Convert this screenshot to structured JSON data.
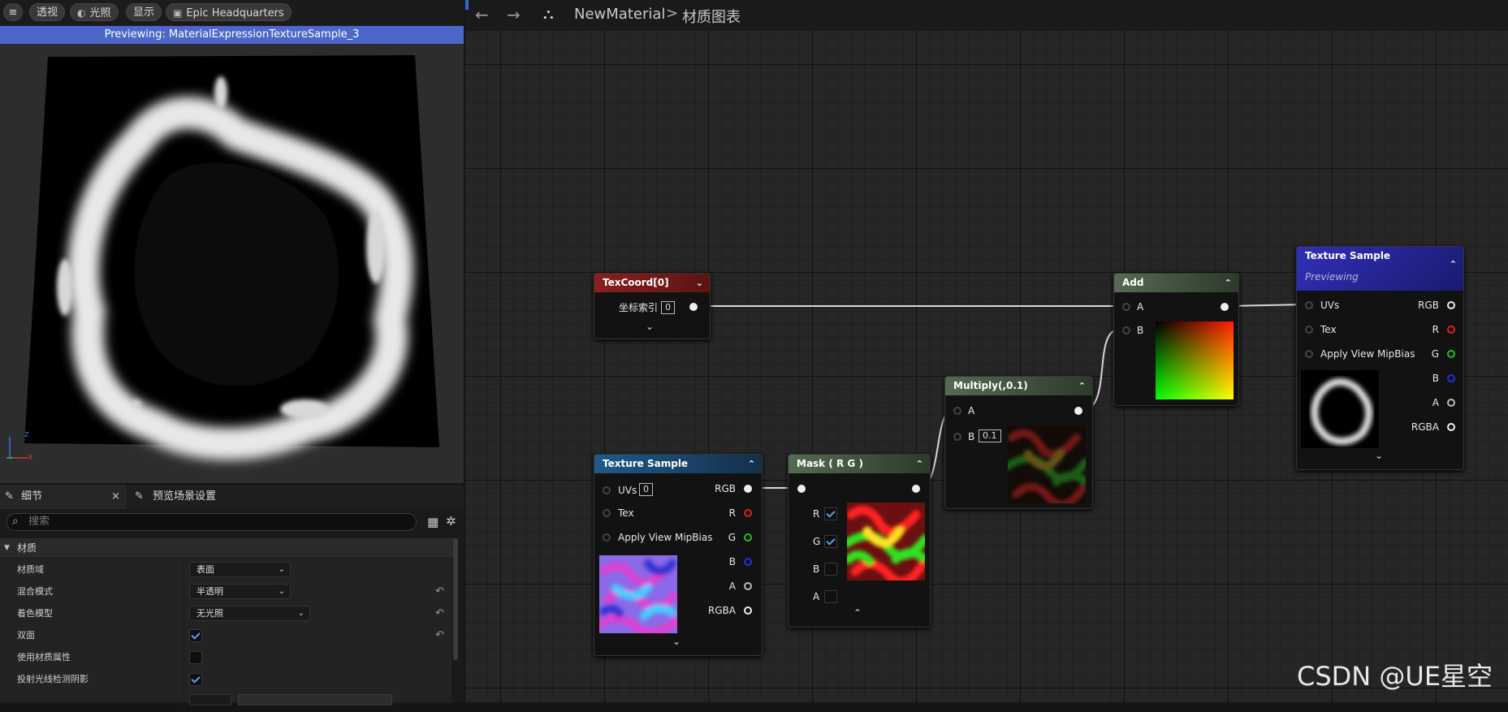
{
  "viewport": {
    "toolbar": {
      "menu_icon": "hamburger-icon",
      "perspective_label": "透视",
      "lit_label": "光照",
      "show_label": "显示",
      "scene_label": "Epic Headquarters"
    },
    "preview_status": "Previewing: MaterialExpressionTextureSample_3",
    "axis": {
      "x": "x",
      "z": "z"
    }
  },
  "details": {
    "tabs": [
      {
        "label": "细节"
      },
      {
        "label": "预览场景设置"
      }
    ],
    "close_glyph": "×",
    "search_placeholder": "搜索",
    "category": "材质",
    "rows": [
      {
        "label": "材质域",
        "type": "dropdown",
        "value": "表面"
      },
      {
        "label": "混合模式",
        "type": "dropdown",
        "value": "半透明"
      },
      {
        "label": "着色模型",
        "type": "dropdown",
        "value": "无光照"
      },
      {
        "label": "双面",
        "type": "checkbox",
        "checked": true
      },
      {
        "label": "使用材质属性",
        "type": "checkbox",
        "checked": false
      },
      {
        "label": "投射光线检测阴影",
        "type": "checkbox",
        "checked": true
      }
    ]
  },
  "graph": {
    "breadcrumb": {
      "asset": "NewMaterial",
      "separator": ">",
      "page": "材质图表"
    },
    "nodes": {
      "texcoord": {
        "title": "TexCoord[0]",
        "index_label": "坐标索引",
        "index_value": "0",
        "color": "#8a1f1f"
      },
      "texture_sample_left": {
        "title": "Texture Sample",
        "color": "#1e4f7a",
        "inputs": [
          "UVs",
          "Tex",
          "Apply View MipBias"
        ],
        "uv_value": "0",
        "outputs": [
          "RGB",
          "R",
          "G",
          "B",
          "A",
          "RGBA"
        ]
      },
      "mask": {
        "title": "Mask ( R G )",
        "color": "#4b6a46",
        "channels": [
          "R",
          "G",
          "B",
          "A"
        ],
        "checked": [
          true,
          true,
          false,
          false
        ]
      },
      "multiply": {
        "title": "Multiply(,0.1)",
        "color": "#4b6a46",
        "inputs": [
          "A",
          "B"
        ],
        "b_value": "0.1"
      },
      "add": {
        "title": "Add",
        "color": "#4b6a46",
        "inputs": [
          "A",
          "B"
        ]
      },
      "texture_sample_right": {
        "title": "Texture Sample",
        "subtitle": "Previewing",
        "color": "#2828a8",
        "inputs": [
          "UVs",
          "Tex",
          "Apply View MipBias"
        ],
        "outputs": [
          "RGB",
          "R",
          "G",
          "B",
          "A",
          "RGBA"
        ]
      }
    },
    "pin_colors": {
      "R": "#e02020",
      "G": "#20c020",
      "B": "#2030e0",
      "A": "#bbbbbb",
      "RGB": "#eeeeee"
    }
  },
  "watermark": "CSDN @UE星空"
}
